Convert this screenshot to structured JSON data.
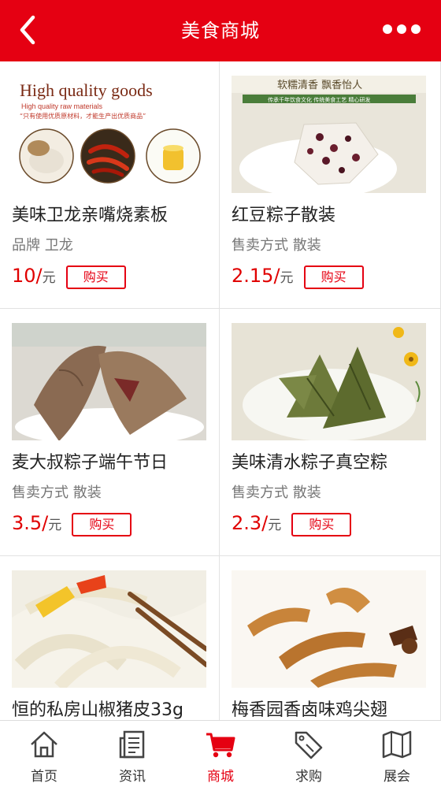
{
  "header": {
    "title": "美食商城",
    "accent": "#e50012"
  },
  "products": [
    {
      "name": "美味卫龙亲嘴烧素板",
      "attr": "品牌 卫龙",
      "price": "10/",
      "unit": "元",
      "buy": "购买",
      "image_text": {
        "headline": "High quality goods",
        "sub": "High quality raw materials",
        "slogan": "“只有使用优质原材料，才能生产出优质商品”"
      }
    },
    {
      "name": "红豆粽子散装",
      "attr": "售卖方式 散装",
      "price": "2.15/",
      "unit": "元",
      "buy": "购买",
      "image_text": {
        "headline": "软糯清香 飘香怡人",
        "sub": "传承千年饮食文化  传统美食工艺  精心研发"
      }
    },
    {
      "name": "麦大叔粽子端午节日",
      "attr": "售卖方式 散装",
      "price": "3.5/",
      "unit": "元",
      "buy": "购买"
    },
    {
      "name": "美味清水粽子真空粽",
      "attr": "售卖方式 散装",
      "price": "2.3/",
      "unit": "元",
      "buy": "购买"
    },
    {
      "name": "恒的私房山椒猪皮33g",
      "attr": "",
      "price": "",
      "unit": "",
      "buy": ""
    },
    {
      "name": "梅香园香卤味鸡尖翅",
      "attr": "",
      "price": "",
      "unit": "",
      "buy": ""
    }
  ],
  "nav": [
    {
      "label": "首页",
      "icon": "home-icon"
    },
    {
      "label": "资讯",
      "icon": "news-icon"
    },
    {
      "label": "商城",
      "icon": "cart-icon",
      "active": true
    },
    {
      "label": "求购",
      "icon": "tag-icon"
    },
    {
      "label": "展会",
      "icon": "map-icon"
    }
  ]
}
